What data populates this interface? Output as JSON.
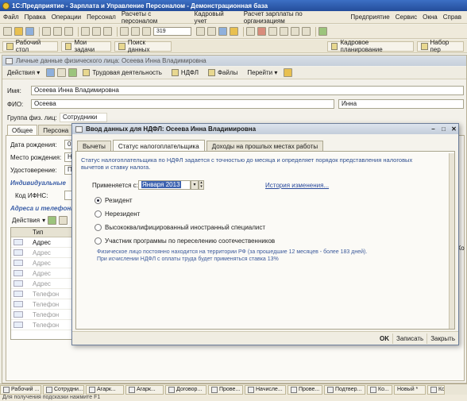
{
  "app_title": "1С:Предприятие - Зарплата и Управление Персоналом - Демонстрационная база",
  "menu": [
    "Файл",
    "Правка",
    "Операции",
    "Персонал",
    "Расчеты с персоналом",
    "Кадровый учет",
    "Расчет зарплаты по организациям",
    "Предприятие",
    "Сервис",
    "Окна",
    "Справ"
  ],
  "toolbar": {
    "search_value": "319"
  },
  "panel": {
    "items": [
      {
        "label": "Рабочий стол"
      },
      {
        "label": "Мои задачи"
      },
      {
        "label": "Поиск данных"
      },
      {
        "label": "Кадровое планирование"
      },
      {
        "label": "Набор пер"
      }
    ]
  },
  "doc": {
    "title": "Личные данные физического лица: Осеева Инна Владимировна",
    "toolbar": [
      "Действия",
      "Трудовая деятельность",
      "НДФЛ",
      "Файлы",
      "Перейти"
    ],
    "name_label": "Имя:",
    "name_value": "Осеева Инна Владимировна",
    "fio_label": "ФИО:",
    "fio_last": "Осеева",
    "fio_first": "Инна",
    "group_label": "Группа физ. лиц:",
    "group_value": "Сотрудники",
    "tabs": [
      "Общее",
      "Персона"
    ],
    "birth_label": "Дата рождения:",
    "birth_value": "0",
    "place_label": "Место рождения:",
    "place_value": "Н",
    "id_label": "Удостоверение:",
    "id_value": "П",
    "section_individual": "Индивидуальные",
    "ifns_label": "Код ИФНС:",
    "section_address": "Адреса и телефоны",
    "actions_label": "Действия",
    "grid_header": "Тип",
    "grid_rows": [
      "Адрес",
      "Адрес",
      "Адрес",
      "Адрес",
      "Адрес",
      "Телефон",
      "Телефон",
      "Телефон",
      "Телефон"
    ],
    "right_cut_label": "Хо"
  },
  "dialog": {
    "title": "Ввод данных для НДФЛ: Осеева Инна Владимировна",
    "tabs": [
      "Вычеты",
      "Статус налогоплательщика",
      "Доходы на прошлых местах работы"
    ],
    "info": "Статус налогоплательщика по НДФЛ задается с точностью до месяца и определяет порядок представления налоговых вычетов и ставку налога.",
    "applies_label": "Применяется с:",
    "applies_value": "Января 2013",
    "history_link": "История изменения...",
    "options": [
      {
        "label": "Резидент",
        "selected": true
      },
      {
        "label": "Нерезидент",
        "selected": false
      },
      {
        "label": "Высококвалифицированный иностранный специалист",
        "selected": false
      },
      {
        "label": "Участник программы по переселению соотечественников",
        "selected": false
      }
    ],
    "note1": "Физическое лицо постоянно находится на территории РФ (за прошедшие 12 месяцев - более 183 дней).",
    "note2": "При исчислении НДФЛ с оплаты труда будет применяться ставка 13%",
    "ok": "OK",
    "save": "Записать",
    "close": "Закрыть"
  },
  "taskbar": [
    "Рабочий ...",
    "Сотрудни...",
    "Агарк...",
    "Агарк...",
    "Договор...",
    "Прове...",
    "Начисле...",
    "Прове...",
    "Подтвер...",
    "Ко...",
    "Новый *",
    "Ко"
  ],
  "status_text": "Для получения подсказки нажмите F1"
}
